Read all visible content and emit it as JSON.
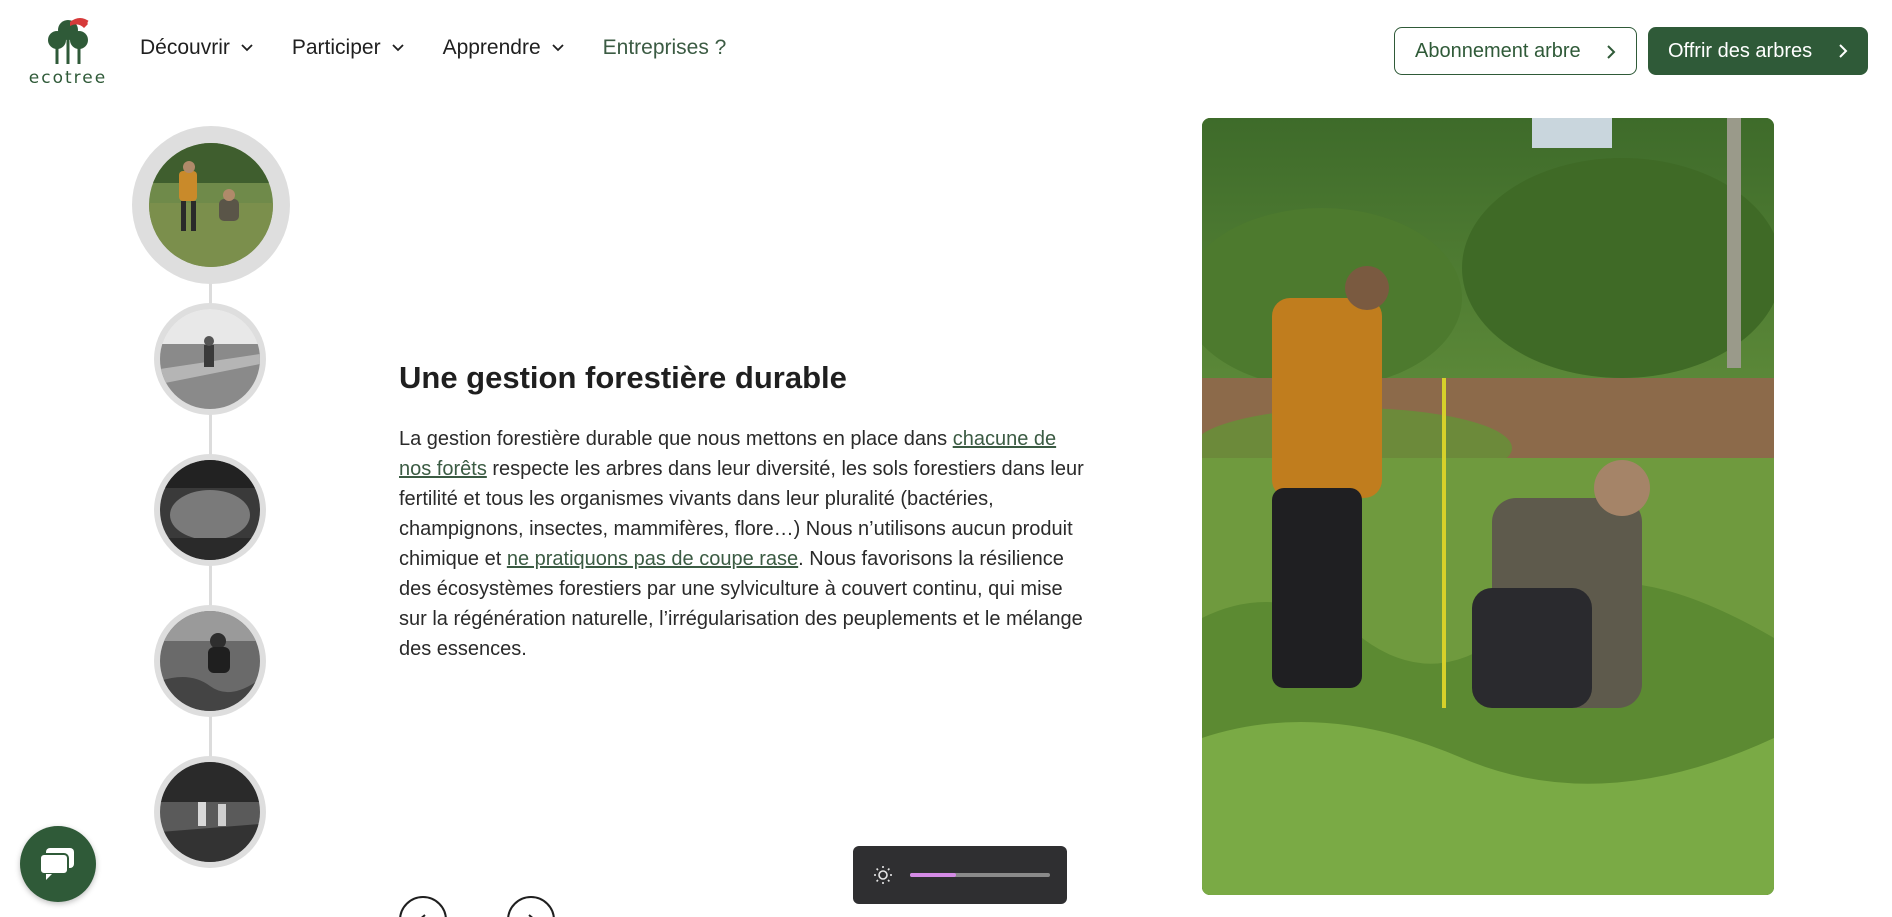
{
  "brand": {
    "name": "ecotree",
    "primary_color": "#2f5a38"
  },
  "nav": {
    "items": [
      {
        "label": "Découvrir",
        "icon": "chevron-down-icon"
      },
      {
        "label": "Participer",
        "icon": "chevron-down-icon"
      },
      {
        "label": "Apprendre",
        "icon": "chevron-down-icon"
      },
      {
        "label": "Entreprises ?"
      }
    ]
  },
  "header_buttons": {
    "subscription": "Abonnement arbre",
    "gift": "Offrir des arbres"
  },
  "timeline": {
    "active_index": 0,
    "count": 5
  },
  "section": {
    "title": "Une gestion forestière durable",
    "text_1": "La gestion forestière durable que nous mettons en place dans ",
    "link_1": "chacune de nos forêts",
    "text_2": " respecte les arbres dans leur diversité, les sols forestiers dans leur fertilité et tous les organismes vivants dans leur pluralité (bactéries, champignons, insectes, mammifères, flore…) Nous n’utilisons aucun produit chimique et ",
    "link_2": "ne pratiquons pas de coupe rase",
    "text_3": ". Nous favorisons la résilience des écosystèmes forestiers par une sylviculture à couvert continu, qui mise sur la régénération naturelle, l’irrégularisation des peuplements et le mélange des essences."
  },
  "carousel_controls": {
    "prev_icon": "chevron-left-icon",
    "next_icon": "chevron-right-icon"
  },
  "chat": {
    "icon": "chat-bubble-icon"
  },
  "brightness": {
    "icon": "sun-icon",
    "level": 0.33
  }
}
